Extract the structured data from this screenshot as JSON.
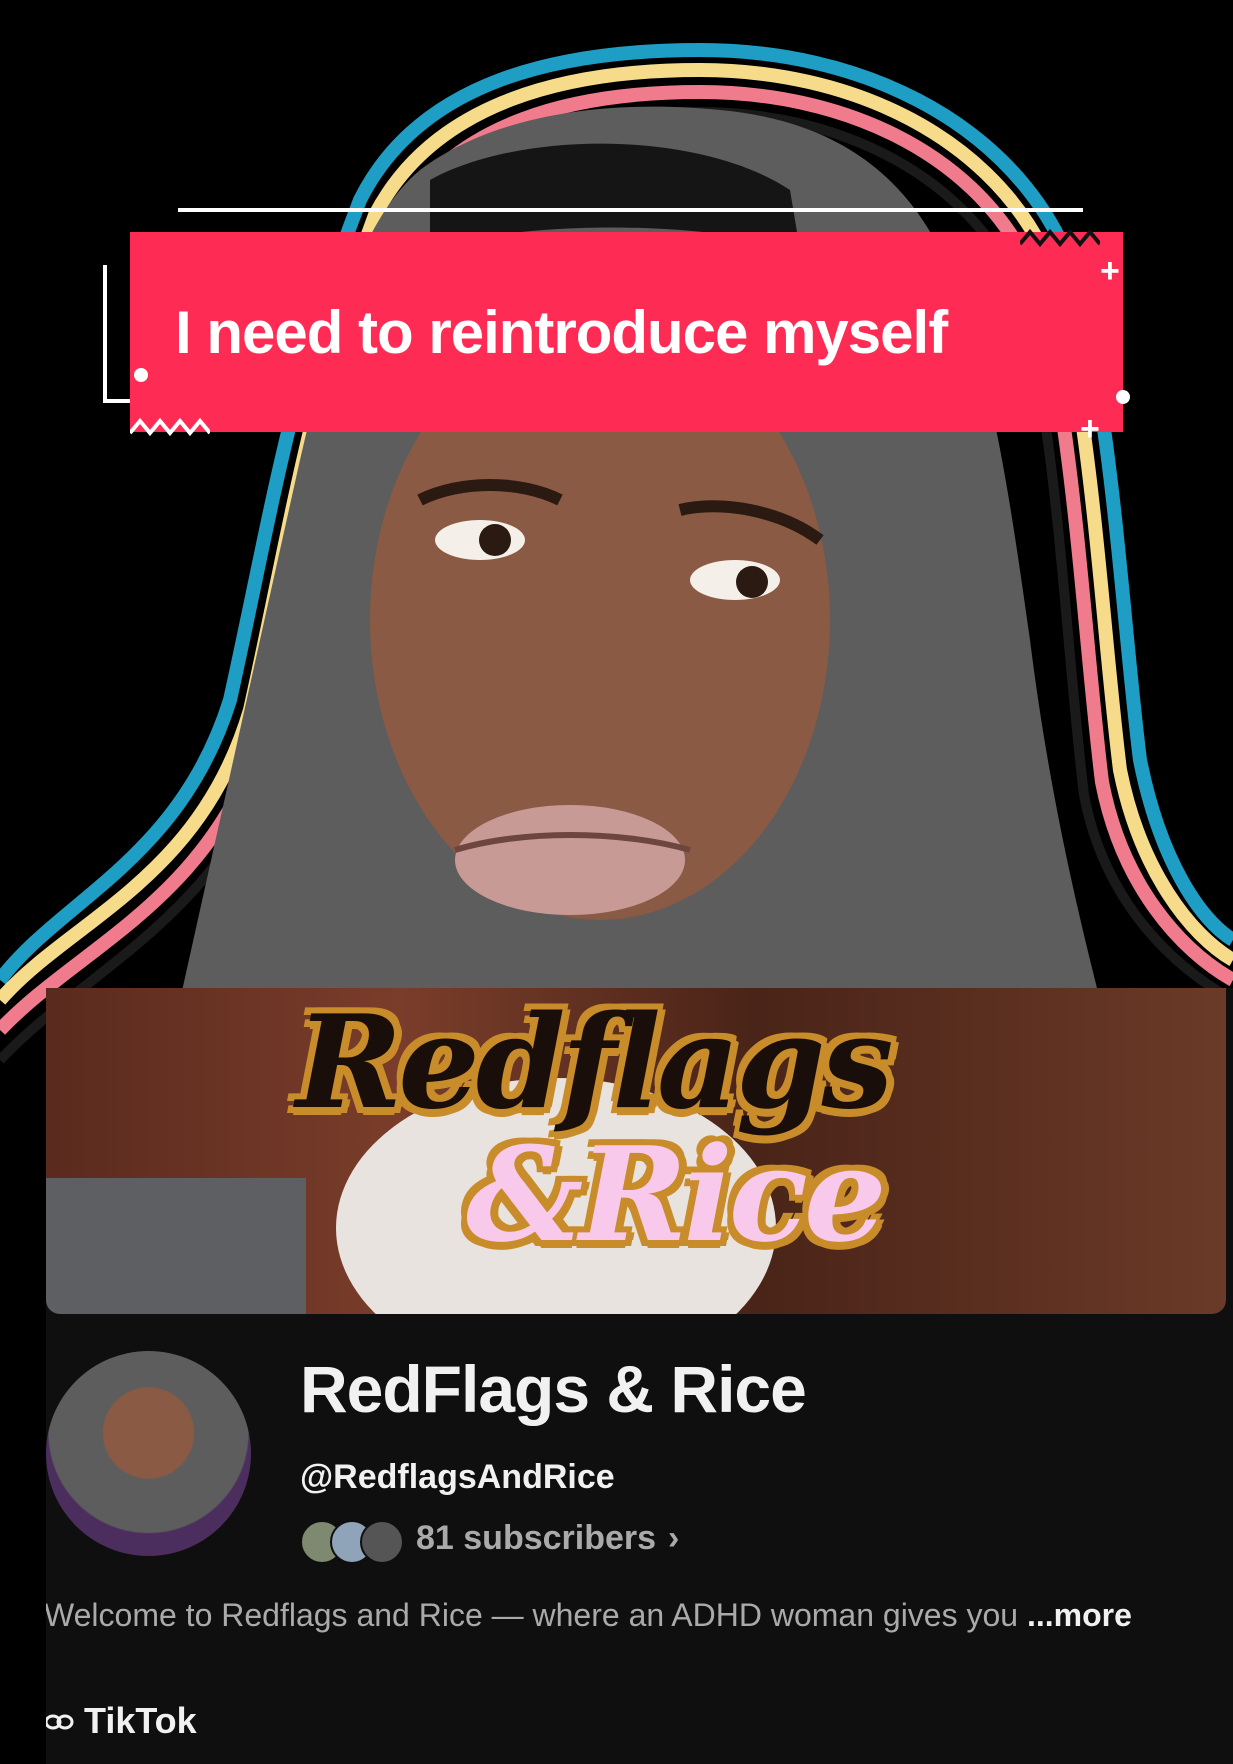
{
  "caption": {
    "text": "I need to reintroduce myself"
  },
  "banner": {
    "line1": "Redflags",
    "line2": "&Rice"
  },
  "channel": {
    "title": "RedFlags & Rice",
    "handle": "@RedflagsAndRice",
    "subscribers": "81 subscribers",
    "subscribers_chevron": "›",
    "description": "Welcome to Redflags and Rice — where an ADHD woman gives you",
    "more_label": " ...more",
    "link_icon": "link-icon",
    "link_label": "TikTok"
  },
  "colors": {
    "caption_bg": "#fe2c55",
    "outline_blue": "#1e9ec4",
    "outline_yellow": "#f6dc8a",
    "outline_pink": "#f07b8c",
    "card_bg": "#0f0f0f"
  }
}
